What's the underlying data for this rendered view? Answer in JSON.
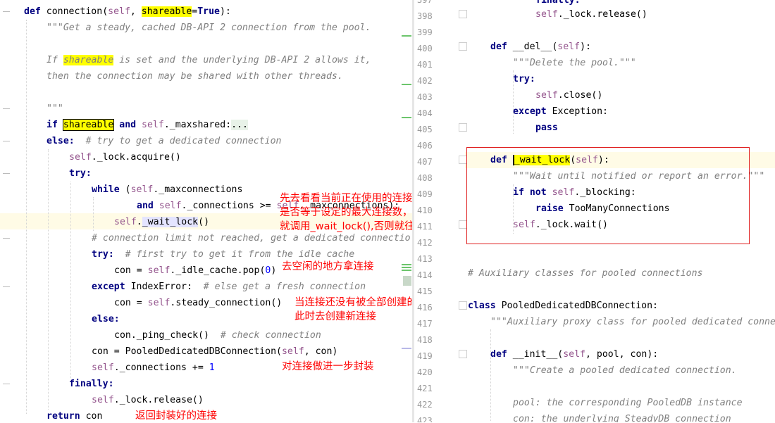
{
  "left": {
    "code": {
      "def_kw": "def",
      "fn_name": "connection",
      "sig_open": "(",
      "self1": "self",
      "sig_sep": ", ",
      "param_shareable": "shareable",
      "sig_eq": "=",
      "true_kw": "True",
      "sig_close": "):",
      "doc1": "\"\"\"Get a steady, cached DB-API 2 connection from the pool.",
      "doc3a": "If ",
      "doc3b": "shareable",
      "doc3c": " is set and the underlying DB-API 2 allows it,",
      "doc4": "then the connection may be shared with other threads.",
      "doc6": "\"\"\"",
      "if_kw": "if",
      "if_shareable": "shareable",
      "if_and": "and",
      "if_self": "self",
      "if_rest": "._maxshared:",
      "if_fold": "...",
      "else_kw": "else:",
      "else_cmt": "# try to get a dedicated connection",
      "acq_self": "self",
      "acq_rest": "._lock.acquire()",
      "try_kw": "try:",
      "while_kw": "while",
      "while_open": " (",
      "while_self": "self",
      "while_rest": "._maxconnections",
      "and_kw": "and",
      "and_self": "self",
      "and_rest": "._connections >= ",
      "and_self2": "self",
      "and_rest2": "._maxconnections):",
      "wait_self": "self",
      "wait_dot": ".",
      "wait_name": "_wait_lock",
      "wait_call": "()",
      "cmt_limit": "# connection limit not reached, get a dedicated connectio",
      "try2_kw": "try:",
      "try2_cmt": "# first try to get it from the idle cache",
      "con1a": "con = ",
      "con1_self": "self",
      "con1b": "._idle_cache.pop(",
      "con1_num": "0",
      "con1c": ")",
      "except_kw": "except",
      "except_rest": " IndexError:  ",
      "except_cmt": "# else get a fresh connection",
      "con2a": "con = ",
      "con2_self": "self",
      "con2b": ".steady_connection()",
      "else2_kw": "else:",
      "ping": "con._ping_check()  ",
      "ping_cmt": "# check connection",
      "pooled_a": "con = PooledDedicatedDBConnection(",
      "pooled_self": "self",
      "pooled_b": ", con)",
      "incr_self": "self",
      "incr_a": "._connections += ",
      "incr_num": "1",
      "finally_kw": "finally:",
      "rel_self": "self",
      "rel_rest": "._lock.release()",
      "return_kw": "return",
      "return_rest": " con"
    },
    "annotations": {
      "a1": "先去看看当前正在使用的连接数\n是否等于设定的最大连接数，大于等于\n就调用_wait_lock(),否则就往下走",
      "a2": "去空闲的地方拿连接",
      "a3": "当连接还没有被全部创建的时候，\n此时去创建新连接",
      "a4": "对连接做进一步封装",
      "a5": "返回封装好的连接"
    }
  },
  "right": {
    "line_numbers": [
      "397",
      "398",
      "399",
      "400",
      "401",
      "402",
      "403",
      "404",
      "405",
      "406",
      "407",
      "408",
      "409",
      "410",
      "411",
      "412",
      "413",
      "414",
      "415",
      "416",
      "417",
      "418",
      "419",
      "420",
      "421",
      "422",
      "423"
    ],
    "code": {
      "l397": "finally:",
      "l398_self": "self",
      "l398_rest": "._lock.release()",
      "l400_def": "def",
      "l400_name": " __del__(",
      "l400_self": "self",
      "l400_close": "):",
      "l401": "\"\"\"Delete the pool.\"\"\"",
      "l402": "try:",
      "l403_self": "self",
      "l403_rest": ".close()",
      "l404_kw": "except",
      "l404_rest": " Exception:",
      "l405": "pass",
      "l407_def": "def",
      "l407_sp": " ",
      "l407_name": "_wait_lock",
      "l407_open": "(",
      "l407_self": "self",
      "l407_close": "):",
      "l408": "\"\"\"Wait until notified or report an error.\"\"\"",
      "l409_if": "if",
      "l409_not": " not ",
      "l409_self": "self",
      "l409_rest": "._blocking:",
      "l410_raise": "raise",
      "l410_rest": " TooManyConnections",
      "l411_self": "self",
      "l411_rest": "._lock.wait()",
      "l414": "# Auxiliary classes for pooled connections",
      "l416_class": "class",
      "l416_rest": " PooledDedicatedDBConnection:",
      "l417": "\"\"\"Auxiliary proxy class for pooled dedicated conne",
      "l419_def": "def",
      "l419_name": " __init__(",
      "l419_self": "self",
      "l419_rest": ", pool, con):",
      "l420": "\"\"\"Create a pooled dedicated connection.",
      "l422": "pool: the corresponding PooledDB instance",
      "l423": "con: the underlying SteadyDB connection"
    }
  },
  "colors": {
    "keyword": "#000080",
    "self": "#94558d",
    "comment": "#808080",
    "number": "#0000ff",
    "highlight": "#ffff00",
    "annotation": "#ff0000"
  }
}
